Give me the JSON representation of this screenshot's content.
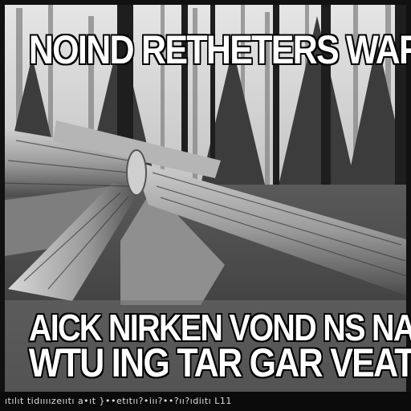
{
  "top_caption": "NOIND RETHETERS WAR",
  "bottom_caption_line1": "AICK NIRKEN   VOND NS NAL AV",
  "bottom_caption_line2": "WTU ING TAR  GAR VEATBL",
  "footer_text": "ıtılıt tidıııızeııtı a•ıt }••etıtıı?•iıı?••?ıı?ıdiıtı L11",
  "colors": {
    "caption_fill": "#ffffff",
    "caption_outline": "#000000",
    "footer_bg": "#0b0b0b"
  }
}
